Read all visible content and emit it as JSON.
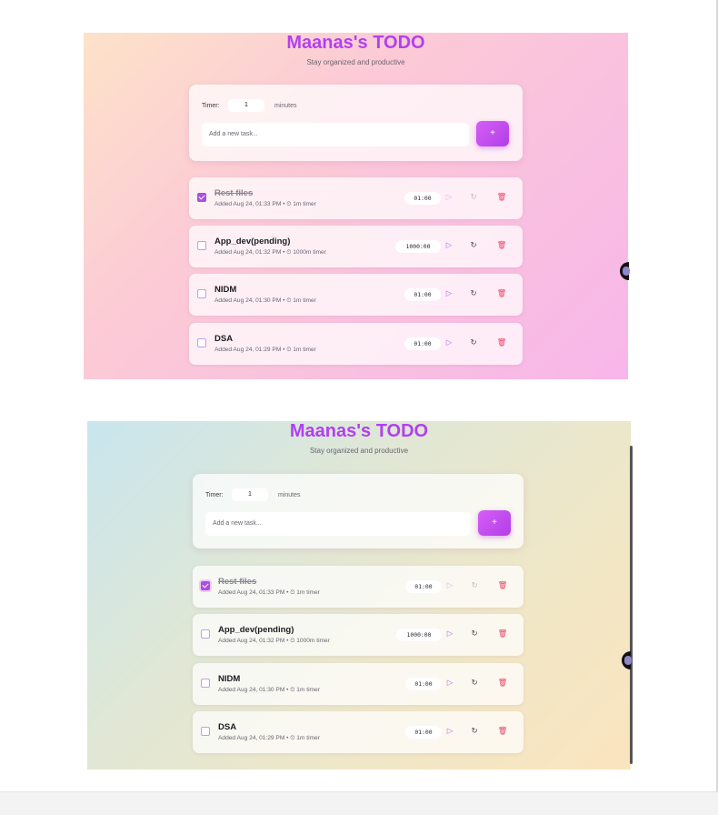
{
  "screens": [
    {
      "title": "Maanas's TODO",
      "subtitle": "Stay organized and productive",
      "timer_label": "Timer:",
      "timer_value": "1",
      "minutes_label": "minutes",
      "task_placeholder": "Add a new task...",
      "add_button": "+",
      "tasks": [
        {
          "name": "Rest files",
          "meta": "Added Aug 24, 01:33 PM  •  ⏲ 1m timer",
          "time": "01:00",
          "completed": true
        },
        {
          "name": "App_dev(pending)",
          "meta": "Added Aug 24, 01:32 PM  •  ⏲ 1000m timer",
          "time": "1000:00",
          "completed": false
        },
        {
          "name": "NIDM",
          "meta": "Added Aug 24, 01:30 PM  •  ⏲ 1m timer",
          "time": "01:00",
          "completed": false
        },
        {
          "name": "DSA",
          "meta": "Added Aug 24, 01:29 PM  •  ⏲ 1m timer",
          "time": "01:00",
          "completed": false
        }
      ],
      "theme": {
        "gradient": [
          "#fde2c8",
          "#f8b6ea"
        ],
        "accent": "#b23ff0"
      }
    },
    {
      "title": "Maanas's TODO",
      "subtitle": "Stay organized and productive",
      "timer_label": "Timer:",
      "timer_value": "1",
      "minutes_label": "minutes",
      "task_placeholder": "Add a new task...",
      "add_button": "+",
      "tasks": [
        {
          "name": "Rest files",
          "meta": "Added Aug 24, 01:33 PM  •  ⏲ 1m timer",
          "time": "01:00",
          "completed": true
        },
        {
          "name": "App_dev(pending)",
          "meta": "Added Aug 24, 01:32 PM  •  ⏲ 1000m timer",
          "time": "1000:00",
          "completed": false
        },
        {
          "name": "NIDM",
          "meta": "Added Aug 24, 01:30 PM  •  ⏲ 1m timer",
          "time": "01:00",
          "completed": false
        },
        {
          "name": "DSA",
          "meta": "Added Aug 24, 01:29 PM  •  ⏲ 1m timer",
          "time": "01:00",
          "completed": false
        }
      ],
      "theme": {
        "gradient": [
          "#c8e6ee",
          "#fbe4bf"
        ],
        "accent": "#b23ff0"
      }
    }
  ],
  "icons": {
    "play": "play-icon",
    "reset": "reset-icon",
    "delete": "trash-icon",
    "timer": "clock-icon"
  }
}
